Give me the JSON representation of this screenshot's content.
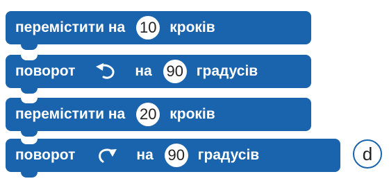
{
  "blocks": [
    {
      "label1": "перемістити на",
      "value": "10",
      "label2": "кроків"
    },
    {
      "label1": "поворот",
      "icon": "rotate-counterclockwise-icon",
      "label_mid": "на",
      "value": "90",
      "label2": "градусів"
    },
    {
      "label1": "перемістити на",
      "value": "20",
      "label2": "кроків"
    },
    {
      "label1": "поворот",
      "icon": "rotate-clockwise-icon",
      "label_mid": "на",
      "value": "90",
      "label2": "градусів"
    }
  ],
  "badge": "d",
  "colors": {
    "block": "#1a63ad",
    "text": "#ffffff"
  }
}
